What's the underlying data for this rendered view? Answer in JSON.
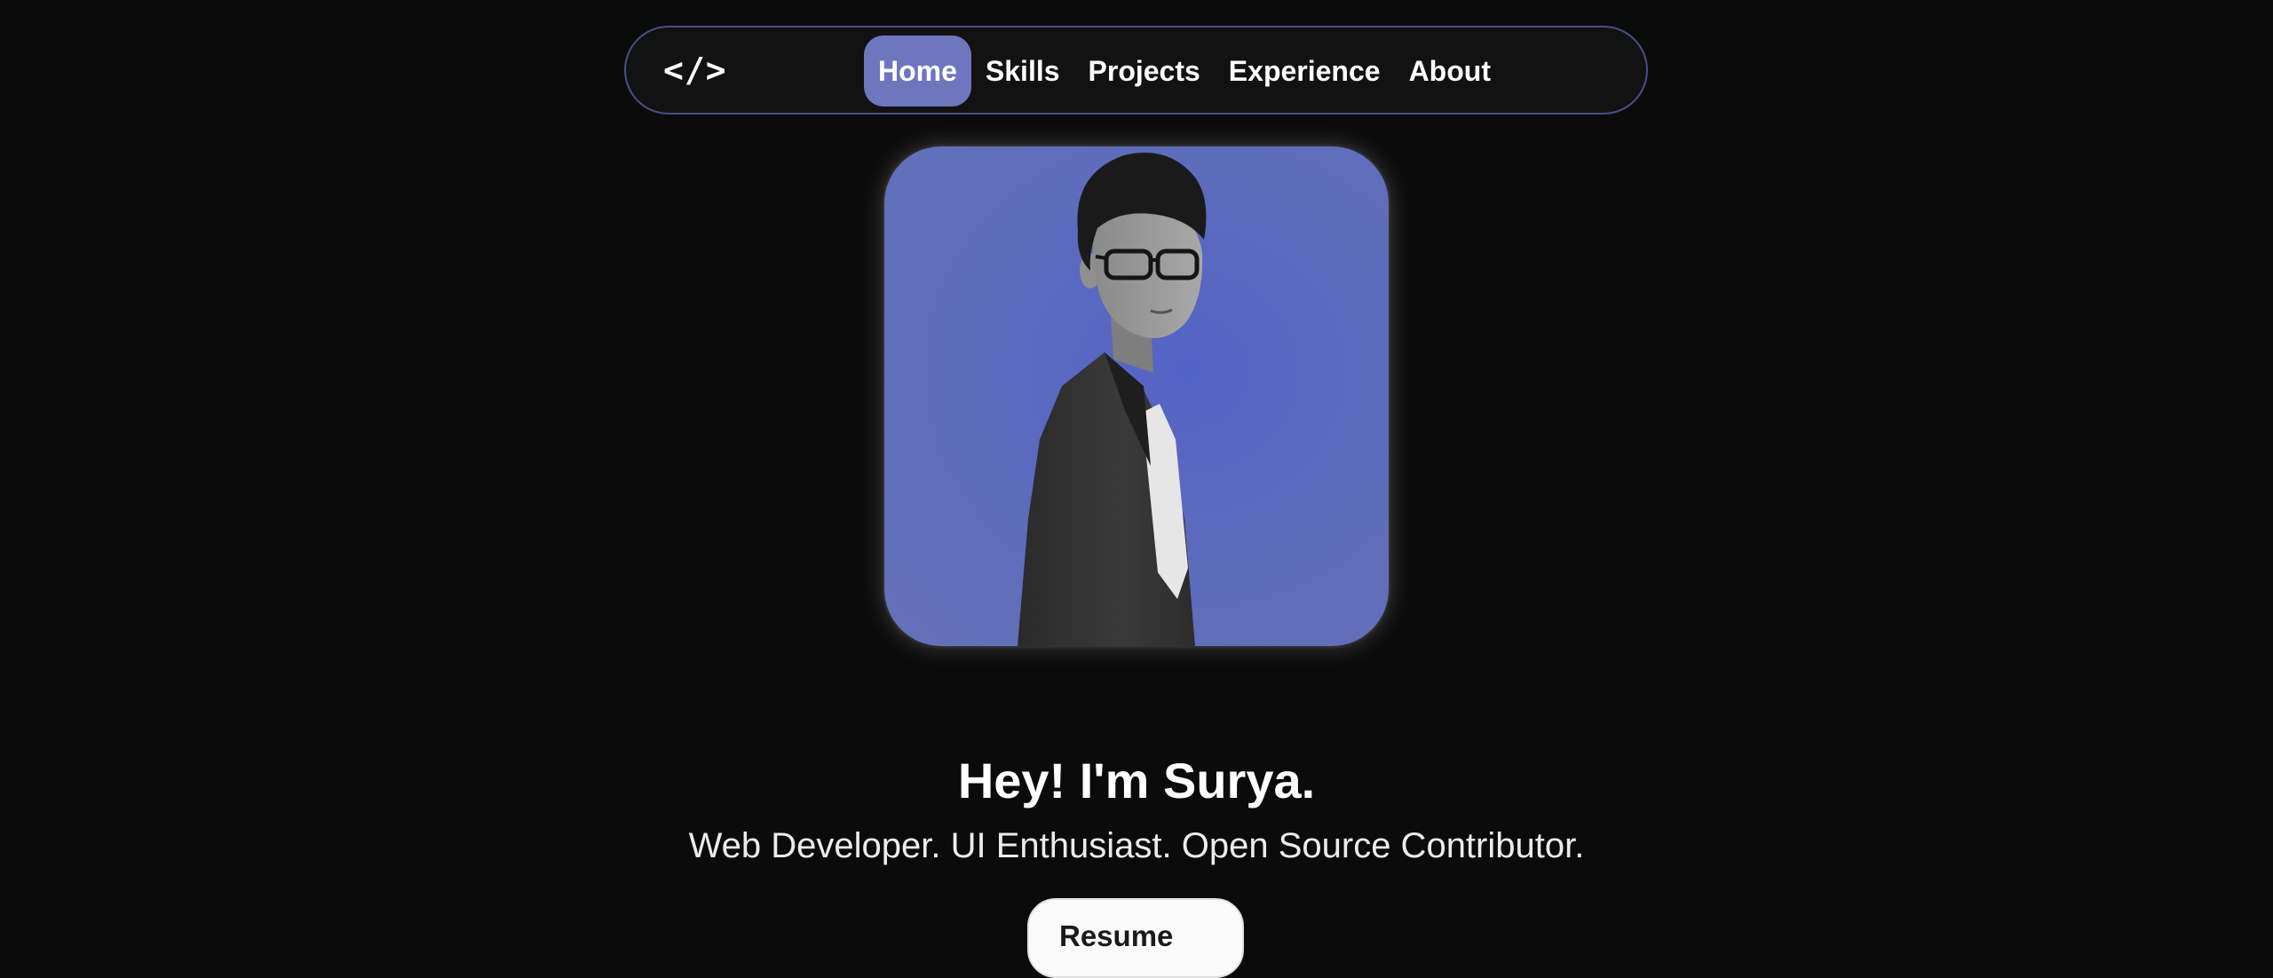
{
  "nav": {
    "logo": "</>",
    "links": [
      {
        "label": "Home",
        "active": true
      },
      {
        "label": "Skills",
        "active": false
      },
      {
        "label": "Projects",
        "active": false
      },
      {
        "label": "Experience",
        "active": false
      },
      {
        "label": "About",
        "active": false
      }
    ],
    "border_color": "#4a4f86",
    "active_color": "#6e76bf"
  },
  "profile": {
    "photo_background_color": "#5e6cbc"
  },
  "hero": {
    "title": "Hey! I'm Surya.",
    "subtitle": "Web Developer. UI Enthusiast. Open Source Contributor.",
    "resume_label": "Resume"
  }
}
